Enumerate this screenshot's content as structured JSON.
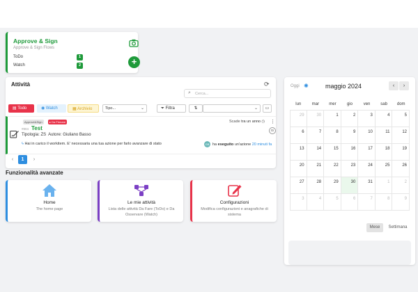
{
  "approve": {
    "title": "Approve & Sign",
    "subtitle": "Approve & Sign Flows",
    "rows": [
      {
        "label": "ToDo",
        "count": "1"
      },
      {
        "label": "Watch",
        "count": "2"
      }
    ],
    "plus": "+"
  },
  "attivita": {
    "title": "Attività",
    "search_placeholder": "Cerca...",
    "tabs": {
      "todo": "Todo",
      "watch": "Watch",
      "archive": "Archivio"
    },
    "tipo_select": "Tipo...",
    "filtra": "Filtra",
    "item": {
      "tag1": "Approve&Sign",
      "tag2": "Da Firmare",
      "scade_prefix": "Scade",
      "scade_value": "tra un anno",
      "id": "#804",
      "name": "Test",
      "tipologia_label": "Tipologia:",
      "tipologia_value": "ZS",
      "autore_label": "Autore:",
      "autore_value": "Giuliano Basso",
      "message": "Hai in carico il workitem. E' necessaria una tua azione per farlo avanzare di stato",
      "avatar": "GB",
      "gi": "Gi",
      "who_prefix": "ha",
      "who_action": "eseguito",
      "who_suffix": "un'azione",
      "time": "20 minuti fa"
    },
    "pager": {
      "prev": "‹",
      "current": "1",
      "next": "›"
    }
  },
  "funzionalita": {
    "title": "Funzionalità avanzate",
    "cards": [
      {
        "title": "Home",
        "desc": "The home page"
      },
      {
        "title": "Le mie attività",
        "desc": "Lista delle attività Da Fare (ToDo) e Da Osservare (Watch)"
      },
      {
        "title": "Configurazioni",
        "desc": "Modifica configurazioni e anagrafiche di sistema"
      }
    ]
  },
  "calendar": {
    "today_label": "Oggi",
    "month": "maggio 2024",
    "prev": "‹",
    "next": "›",
    "weekdays": [
      "lun",
      "mar",
      "mer",
      "gio",
      "ven",
      "sab",
      "dom"
    ],
    "weeks": [
      [
        "29",
        "30",
        "1",
        "2",
        "3",
        "4",
        "5"
      ],
      [
        "6",
        "7",
        "8",
        "9",
        "10",
        "11",
        "12"
      ],
      [
        "13",
        "14",
        "15",
        "16",
        "17",
        "18",
        "19"
      ],
      [
        "20",
        "21",
        "22",
        "23",
        "24",
        "25",
        "26"
      ],
      [
        "27",
        "28",
        "29",
        "30",
        "31",
        "1",
        "2"
      ],
      [
        "3",
        "4",
        "5",
        "6",
        "7",
        "8",
        "9"
      ]
    ],
    "today_day": "30",
    "views": {
      "month": "Mese",
      "week": "Settimana"
    }
  }
}
